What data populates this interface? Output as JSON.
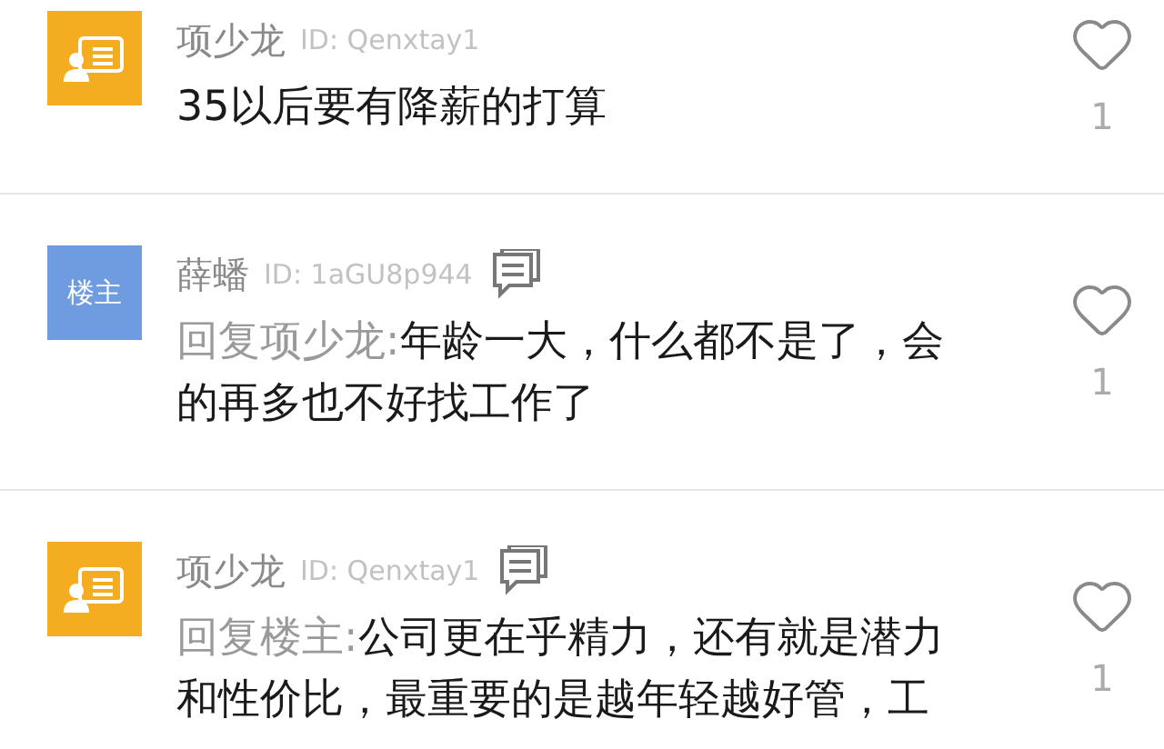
{
  "comments": [
    {
      "avatar": {
        "kind": "icon"
      },
      "name": "项少龙",
      "user_id": "ID: Qenxtay1",
      "message_icon": false,
      "lines": [
        "35以后要有降薪的打算"
      ],
      "likes": "1"
    },
    {
      "avatar": {
        "kind": "label",
        "text": "楼主"
      },
      "name": "薛蟠",
      "user_id": "ID: 1aGU8p944",
      "message_icon": true,
      "reply_prefix": "回复项少龙:",
      "lines": [
        "年龄一大，什么都不是了，会",
        "的再多也不好找工作了"
      ],
      "likes": "1"
    },
    {
      "avatar": {
        "kind": "icon"
      },
      "name": "项少龙",
      "user_id": "ID: Qenxtay1",
      "message_icon": true,
      "reply_prefix": "回复楼主:",
      "lines": [
        "公司更在乎精力，还有就是潜力",
        "和性价比，最重要的是越年轻越好管，工"
      ],
      "likes": "1"
    }
  ]
}
